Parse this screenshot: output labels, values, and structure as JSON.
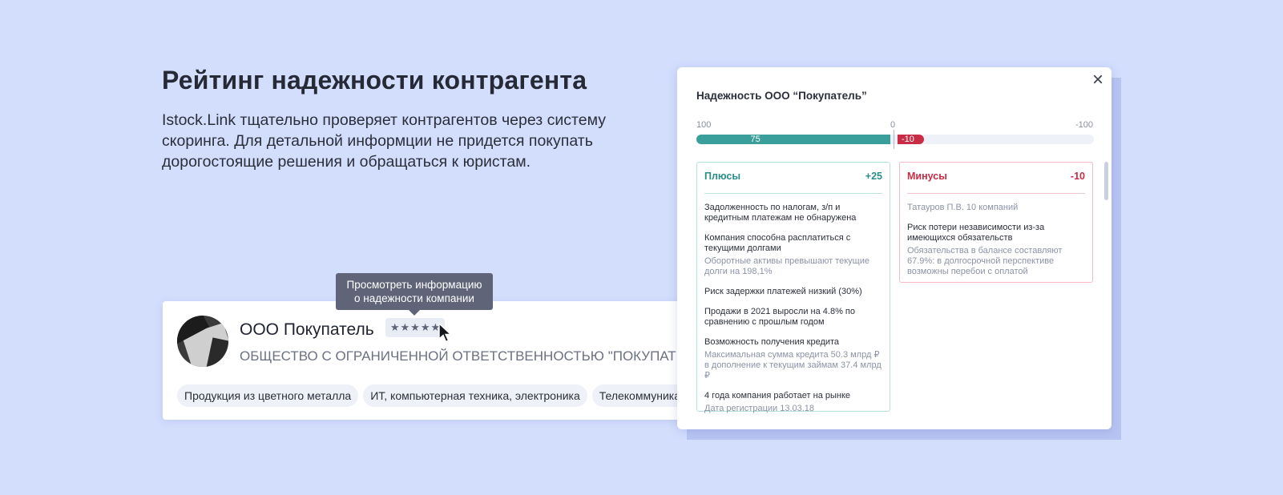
{
  "hero": {
    "title": "Рейтинг надежности контрагента",
    "description": "Istock.Link тщательно проверяет контрагентов через систему скоринга. Для детальной информции не придется покупать дорогостоящие решения и обращаться к юристам."
  },
  "card": {
    "name": "ООО Покупатель",
    "full_name": "ОБЩЕСТВО С ОГРАНИЧЕННОЙ ОТВЕТСТВЕННОСТЬЮ \"ПОКУПАТЕЛЬ\"",
    "stars": 5,
    "tags": [
      "Продукция из цветного металла",
      "ИТ, компьютерная техника, электроника",
      "Телекоммуникации"
    ]
  },
  "tooltip": {
    "line1": "Просмотреть информацию",
    "line2": "о надежности компании"
  },
  "modal": {
    "title": "Надежность ООО “Покупатель”",
    "axis_left": "100",
    "axis_zero": "0",
    "axis_right": "-100",
    "score_positive": 75,
    "score_negative": -10,
    "plus_label": "Плюсы",
    "plus_score": "+25",
    "minus_label": "Минусы",
    "minus_score": "-10",
    "plus_items": [
      {
        "main": "Задолженность по налогам, з/п и кредитным платежам не обнаружена",
        "sub": ""
      },
      {
        "main": "Компания способна расплатиться с текущими долгами",
        "sub": "Оборотные активы превышают текущие долги на 198,1%"
      },
      {
        "main": "Риск задержки платежей низкий (30%)",
        "sub": ""
      },
      {
        "main": "Продажи в 2021 выросли на 4.8% по сравнению с прошлым годом",
        "sub": ""
      },
      {
        "main": "Возможность получения кредита",
        "sub": "Максимальная сумма кредита 50.3 млрд ₽ в дополнение к текущим займам 37.4 млрд ₽"
      },
      {
        "main": "4 года компания работает на рынке",
        "sub": "Дата регистрации 13.03.18"
      }
    ],
    "minus_items": [
      {
        "main": "",
        "sub": "Татауров П.В. 10 компаний"
      },
      {
        "main": "Риск потери независимости из-за имеющихся обязательств",
        "sub": "Обязательства в балансе составляют 67.9%: в долгосрочной перспективе возможны перебои с оплатой"
      }
    ]
  },
  "colors": {
    "background": "#d3defd",
    "positive": "#3a9e9b",
    "negative": "#c92c45",
    "tooltip": "#5f6478"
  },
  "icons": [
    "close-icon",
    "star-icon",
    "cursor-icon"
  ]
}
